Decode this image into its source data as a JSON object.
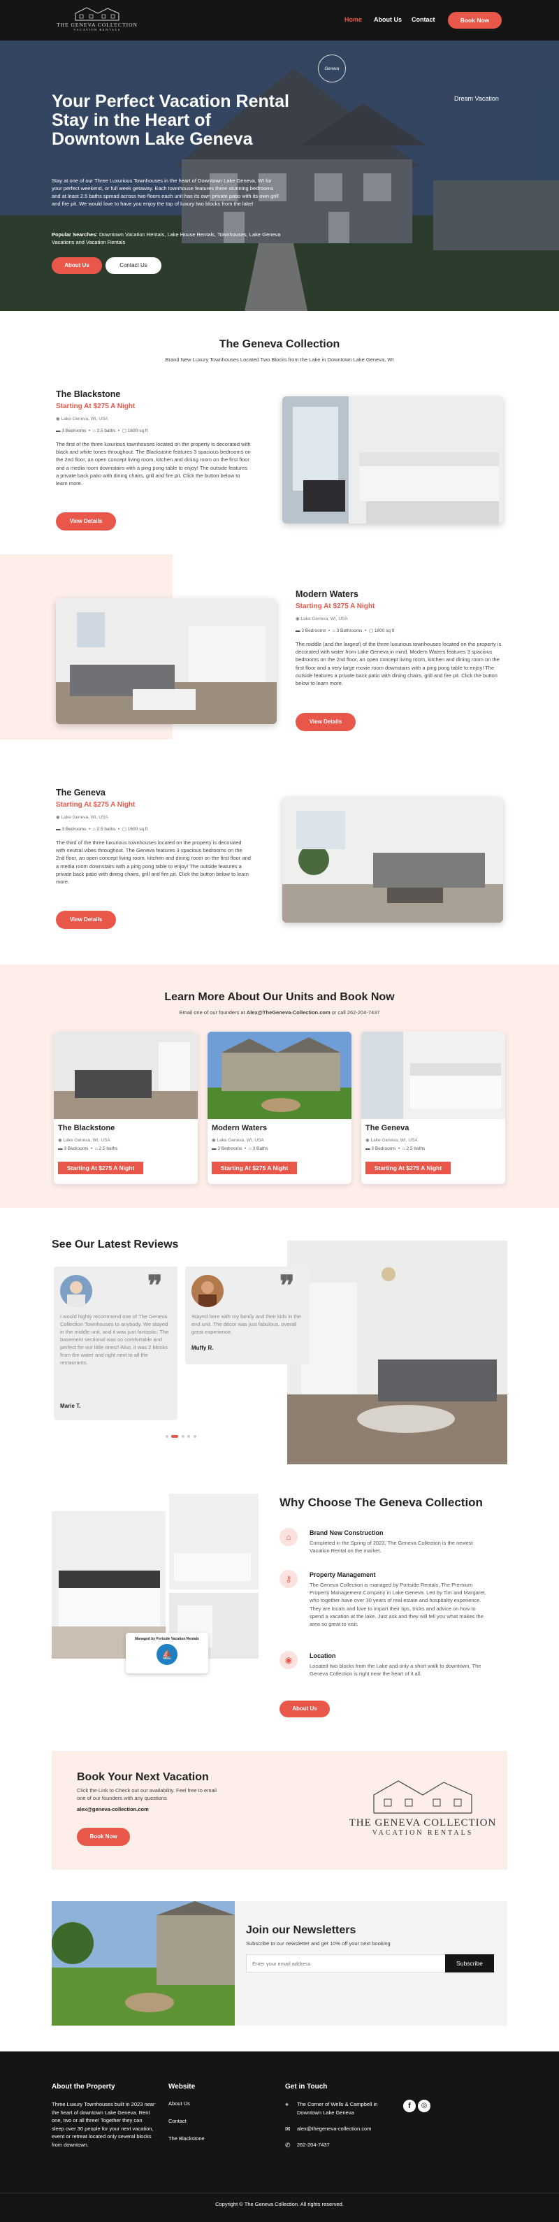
{
  "header": {
    "logo_text_1": "THE GENEVA COLLECTION",
    "logo_text_2": "VACATION RENTALS",
    "nav": [
      "Home",
      "About Us",
      "Contact"
    ],
    "book_button": "Book Now"
  },
  "hero": {
    "title": "Your Perfect Vacation Rental Stay in the Heart of Downtown Lake Geneva",
    "paragraph": "Stay at one of our Three Luxurious Townhouses in the heart of Downtown Lake Geneva, WI for your perfect weekend, or full week getaway. Each townhouse features three stunning bedrooms and at least 2.5 baths spread across two floors each unit has its own private patio with its own grill and fire pit. We would love to have you enjoy the top of luxury two blocks from the lake!",
    "popular_label": "Popular Searches:",
    "popular_text": "Downtown Vacation Rentals, Lake House Rentals, Townhouses, Lake Geneva Vacations and Vacation Rentals",
    "about_button": "About Us",
    "contact_button": "Contact Us",
    "badge_text": "Dream Vacation",
    "script_text": "Geneva"
  },
  "collection": {
    "title": "The Geneva Collection",
    "subtitle": "Brand New Luxury Townhouses Located Two Blocks from the Lake in Downtown Lake Geneva, WI",
    "properties": [
      {
        "name": "The Blackstone",
        "price": "Starting At $275 A Night",
        "location": "Lake Geneva, WI, USA",
        "bedrooms": "3 Bedrooms",
        "baths": "2.5 baths",
        "sqft": "1600 sq ft",
        "description": "The first of the three luxurious townhouses located on the property is decorated with black and white tones throughout. The Blackstone features 3 spacious bedrooms on the 2nd floor, an open concept living room, kitchen and dining room on the first floor and a media room downstairs with a ping pong table to enjoy! The outside features a private back patio with dining chairs, grill and fire pit. Click the button below to learn more.",
        "button": "View Details"
      },
      {
        "name": "Modern Waters",
        "price": "Starting At $275 A Night",
        "location": "Lake Geneva, WI, USA",
        "bedrooms": "3 Bedrooms",
        "baths": "3 Bathrooms",
        "sqft": "1800 sq ft",
        "description": "The middle (and the largest) of the three luxurious townhouses located on the property is decorated with water from Lake Geneva in mind. Modern Waters features 3 spacious bedrooms on the 2nd floor, an open concept living room, kitchen and dining room on the first floor and a very large movie room downstairs with a ping pong table to enjoy! The outside features a private back patio with dining chairs, grill and fire pit. Click the button below to learn more.",
        "button": "View Details"
      },
      {
        "name": "The Geneva",
        "price": "Starting At $275 A Night",
        "location": "Lake Geneva, WI, USA",
        "bedrooms": "3 Bedrooms",
        "baths": "2.5 baths",
        "sqft": "1600 sq ft",
        "description": "The third of the three luxurious townhouses located on the property is decorated with neutral vibes throughout. The Geneva features 3 spacious bedrooms on the 2nd floor, an open concept living room, kitchen and dining room on the first floor and a media room downstairs with a ping pong table to enjoy! The outside features a private back patio with dining chairs, grill and fire pit. Click the button below to learn more.",
        "button": "View Details"
      }
    ]
  },
  "learn_more": {
    "title": "Learn More About Our Units and Book Now",
    "subtitle_prefix": "Email one of our founders at ",
    "email": "Alex@TheGeneva-Collection.com",
    "subtitle_suffix": " or call 262-204-7437",
    "cards": [
      {
        "name": "The Blackstone",
        "location": "Lake Geneva, WI, USA",
        "bedrooms": "3 Bedrooms",
        "baths": "2.5 baths",
        "price": "Starting At $275 A Night"
      },
      {
        "name": "Modern Waters",
        "location": "Lake Geneva, WI, USA",
        "bedrooms": "3 Bedrooms",
        "baths": "3 Baths",
        "price": "Starting At $275 A Night"
      },
      {
        "name": "The Geneva",
        "location": "Lake Geneva, WI, USA",
        "bedrooms": "3 Bedrooms",
        "baths": "2.5 baths",
        "price": "Starting At $275 A Night"
      }
    ]
  },
  "reviews": {
    "title": "See Our Latest Reviews",
    "items": [
      {
        "text": "I would highly recommend one of The Geneva Collection Townhouses to anybody. We stayed in the middle unit, and it was just fantastic. The basement sectional was so comfortable and perfect for our little ones!! Also, it was 2 blocks from the water and right next to all the restaurants.",
        "name": "Marie T."
      },
      {
        "text": "Stayed here with my family and their kids in the end unit. The décor was just fabulous, overall great experience.",
        "name": "Muffy R."
      }
    ]
  },
  "why": {
    "title": "Why Choose The Geneva Collection",
    "badge_text": "Managed by Portside Vacation Rentals",
    "items": [
      {
        "title": "Brand New Construction",
        "text": "Completed in the Spring of 2023, The Geneva Collection is the newest Vacation Rental on the market."
      },
      {
        "title": "Property Management",
        "text": "The Geneva Collection is managed by Portside Rentals, The Premium Property Management Company in Lake Geneva. Led by Tim and Margaret, who together have over 30 years of real estate and hospitality experience. They are locals and love to impart their tips, tricks and advice on how to spend a vacation at the lake. Just ask and they will tell you what makes the area so great to visit."
      },
      {
        "title": "Location",
        "text": "Located two blocks from the Lake and only a short walk to downtown, The Geneva Collection is right near the heart of it all."
      }
    ],
    "button": "About Us"
  },
  "book": {
    "title": "Book Your Next Vacation",
    "text": "Click the Link to Check out our availability. Feel free to email one of our founders with any questions",
    "email": "alex@geneva-collection.com",
    "button": "Book Now",
    "logo_1": "THE GENEVA COLLECTION",
    "logo_2": "VACATION RENTALS"
  },
  "newsletter": {
    "title": "Join our Newsletters",
    "subtitle": "Subscribe to our newsletter and get 10% off your next booking",
    "placeholder": "Enter your email address",
    "button": "Subscribe"
  },
  "footer": {
    "about_title": "About the Property",
    "about_text": "Three Luxury Townhouses built in 2023 near the heart of downtown Lake Geneva. Rent one, two or all three! Together they can sleep over 30 people for your next vacation, event or retreat located only several blocks from downtown.",
    "website_title": "Website",
    "links": [
      "About Us",
      "Contact",
      "The Blackstone"
    ],
    "contact_title": "Get in Touch",
    "address": "The Corner of Wells & Campbell in Downtown Lake Geneva",
    "email": "alex@thegeneva-collection.com",
    "phone": "262-204-7437",
    "copyright": "Copyright © The Geneva Collection. All rights reserved."
  },
  "colors": {
    "accent": "#e8574a",
    "pink_bg": "#fdeeea",
    "dark": "#151515"
  }
}
